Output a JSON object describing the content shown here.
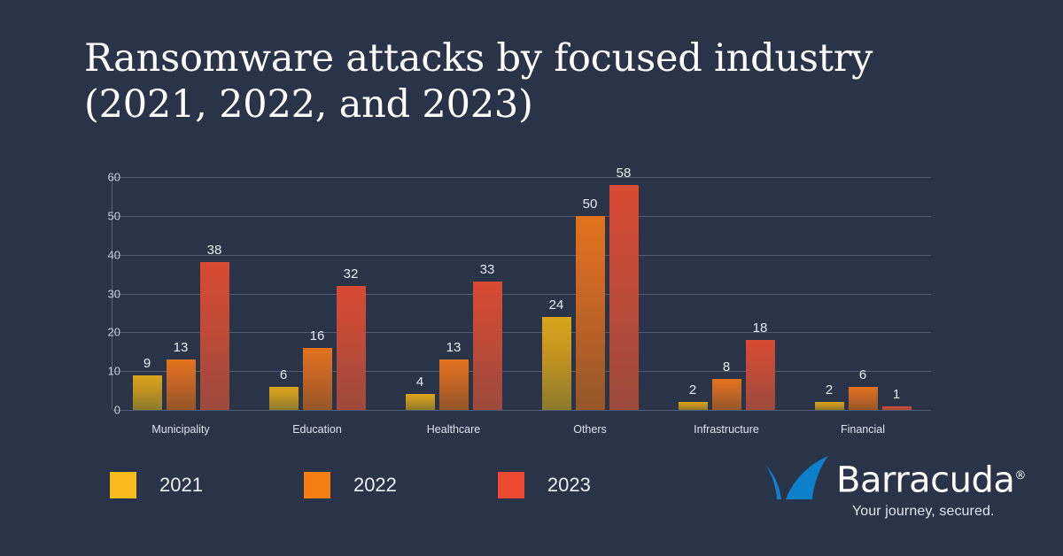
{
  "title": {
    "line1": "Ransomware attacks by focused industry",
    "line2": "(2021, 2022, and 2023)"
  },
  "colors": {
    "background": "#2a3449",
    "series_2021": "#f9ba1b",
    "series_2022": "#f67d12",
    "series_2023": "#ef4b33",
    "gridline": "#515c75",
    "text": "#ffffff",
    "logo_blue": "#0d80cc"
  },
  "brand": {
    "name": "Barracuda",
    "registered_mark": "®",
    "tagline": "Your journey, secured.",
    "logo_icon": "shark-fin-icon"
  },
  "legend": {
    "position": "bottom-left",
    "items": [
      {
        "label": "2021",
        "color": "#f9ba1b"
      },
      {
        "label": "2022",
        "color": "#f67d12"
      },
      {
        "label": "2023",
        "color": "#ef4b33"
      }
    ]
  },
  "axis": {
    "y_ticks": [
      "0",
      "10",
      "20",
      "30",
      "40",
      "50",
      "60"
    ]
  },
  "chart_data": {
    "type": "bar",
    "title": "Ransomware attacks by focused industry (2021, 2022, and 2023)",
    "xlabel": "",
    "ylabel": "",
    "ylim": [
      0,
      60
    ],
    "yticks": [
      0,
      10,
      20,
      30,
      40,
      50,
      60
    ],
    "grid": true,
    "legend_position": "bottom-left",
    "categories": [
      "Municipality",
      "Education",
      "Healthcare",
      "Others",
      "Infrastructure",
      "Financial"
    ],
    "series": [
      {
        "name": "2021",
        "color": "#f9ba1b",
        "values": [
          9,
          6,
          4,
          24,
          2,
          2
        ]
      },
      {
        "name": "2022",
        "color": "#f67d12",
        "values": [
          13,
          16,
          13,
          50,
          8,
          6
        ]
      },
      {
        "name": "2023",
        "color": "#ef4b33",
        "values": [
          38,
          32,
          33,
          58,
          18,
          1
        ]
      }
    ],
    "data_labels": true
  }
}
